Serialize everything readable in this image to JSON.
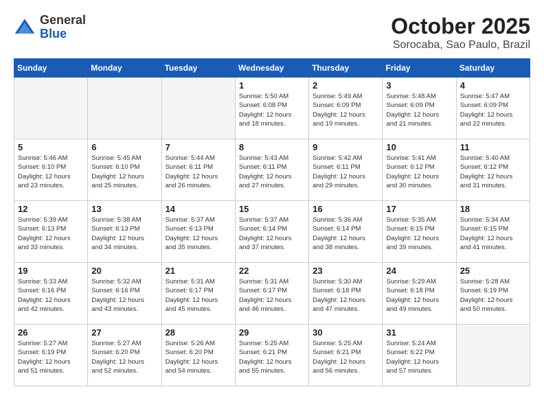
{
  "header": {
    "logo_general": "General",
    "logo_blue": "Blue",
    "month_title": "October 2025",
    "location": "Sorocaba, Sao Paulo, Brazil"
  },
  "weekdays": [
    "Sunday",
    "Monday",
    "Tuesday",
    "Wednesday",
    "Thursday",
    "Friday",
    "Saturday"
  ],
  "weeks": [
    [
      {
        "day": "",
        "info": ""
      },
      {
        "day": "",
        "info": ""
      },
      {
        "day": "",
        "info": ""
      },
      {
        "day": "1",
        "info": "Sunrise: 5:50 AM\nSunset: 6:08 PM\nDaylight: 12 hours\nand 18 minutes."
      },
      {
        "day": "2",
        "info": "Sunrise: 5:49 AM\nSunset: 6:09 PM\nDaylight: 12 hours\nand 19 minutes."
      },
      {
        "day": "3",
        "info": "Sunrise: 5:48 AM\nSunset: 6:09 PM\nDaylight: 12 hours\nand 21 minutes."
      },
      {
        "day": "4",
        "info": "Sunrise: 5:47 AM\nSunset: 6:09 PM\nDaylight: 12 hours\nand 22 minutes."
      }
    ],
    [
      {
        "day": "5",
        "info": "Sunrise: 5:46 AM\nSunset: 6:10 PM\nDaylight: 12 hours\nand 23 minutes."
      },
      {
        "day": "6",
        "info": "Sunrise: 5:45 AM\nSunset: 6:10 PM\nDaylight: 12 hours\nand 25 minutes."
      },
      {
        "day": "7",
        "info": "Sunrise: 5:44 AM\nSunset: 6:11 PM\nDaylight: 12 hours\nand 26 minutes."
      },
      {
        "day": "8",
        "info": "Sunrise: 5:43 AM\nSunset: 6:11 PM\nDaylight: 12 hours\nand 27 minutes."
      },
      {
        "day": "9",
        "info": "Sunrise: 5:42 AM\nSunset: 6:11 PM\nDaylight: 12 hours\nand 29 minutes."
      },
      {
        "day": "10",
        "info": "Sunrise: 5:41 AM\nSunset: 6:12 PM\nDaylight: 12 hours\nand 30 minutes."
      },
      {
        "day": "11",
        "info": "Sunrise: 5:40 AM\nSunset: 6:12 PM\nDaylight: 12 hours\nand 31 minutes."
      }
    ],
    [
      {
        "day": "12",
        "info": "Sunrise: 5:39 AM\nSunset: 6:13 PM\nDaylight: 12 hours\nand 33 minutes."
      },
      {
        "day": "13",
        "info": "Sunrise: 5:38 AM\nSunset: 6:13 PM\nDaylight: 12 hours\nand 34 minutes."
      },
      {
        "day": "14",
        "info": "Sunrise: 5:37 AM\nSunset: 6:13 PM\nDaylight: 12 hours\nand 35 minutes."
      },
      {
        "day": "15",
        "info": "Sunrise: 5:37 AM\nSunset: 6:14 PM\nDaylight: 12 hours\nand 37 minutes."
      },
      {
        "day": "16",
        "info": "Sunrise: 5:36 AM\nSunset: 6:14 PM\nDaylight: 12 hours\nand 38 minutes."
      },
      {
        "day": "17",
        "info": "Sunrise: 5:35 AM\nSunset: 6:15 PM\nDaylight: 12 hours\nand 39 minutes."
      },
      {
        "day": "18",
        "info": "Sunrise: 5:34 AM\nSunset: 6:15 PM\nDaylight: 12 hours\nand 41 minutes."
      }
    ],
    [
      {
        "day": "19",
        "info": "Sunrise: 5:33 AM\nSunset: 6:16 PM\nDaylight: 12 hours\nand 42 minutes."
      },
      {
        "day": "20",
        "info": "Sunrise: 5:32 AM\nSunset: 6:16 PM\nDaylight: 12 hours\nand 43 minutes."
      },
      {
        "day": "21",
        "info": "Sunrise: 5:31 AM\nSunset: 6:17 PM\nDaylight: 12 hours\nand 45 minutes."
      },
      {
        "day": "22",
        "info": "Sunrise: 5:31 AM\nSunset: 6:17 PM\nDaylight: 12 hours\nand 46 minutes."
      },
      {
        "day": "23",
        "info": "Sunrise: 5:30 AM\nSunset: 6:18 PM\nDaylight: 12 hours\nand 47 minutes."
      },
      {
        "day": "24",
        "info": "Sunrise: 5:29 AM\nSunset: 6:18 PM\nDaylight: 12 hours\nand 49 minutes."
      },
      {
        "day": "25",
        "info": "Sunrise: 5:28 AM\nSunset: 6:19 PM\nDaylight: 12 hours\nand 50 minutes."
      }
    ],
    [
      {
        "day": "26",
        "info": "Sunrise: 5:27 AM\nSunset: 6:19 PM\nDaylight: 12 hours\nand 51 minutes."
      },
      {
        "day": "27",
        "info": "Sunrise: 5:27 AM\nSunset: 6:20 PM\nDaylight: 12 hours\nand 52 minutes."
      },
      {
        "day": "28",
        "info": "Sunrise: 5:26 AM\nSunset: 6:20 PM\nDaylight: 12 hours\nand 54 minutes."
      },
      {
        "day": "29",
        "info": "Sunrise: 5:25 AM\nSunset: 6:21 PM\nDaylight: 12 hours\nand 55 minutes."
      },
      {
        "day": "30",
        "info": "Sunrise: 5:25 AM\nSunset: 6:21 PM\nDaylight: 12 hours\nand 56 minutes."
      },
      {
        "day": "31",
        "info": "Sunrise: 5:24 AM\nSunset: 6:22 PM\nDaylight: 12 hours\nand 57 minutes."
      },
      {
        "day": "",
        "info": ""
      }
    ]
  ]
}
